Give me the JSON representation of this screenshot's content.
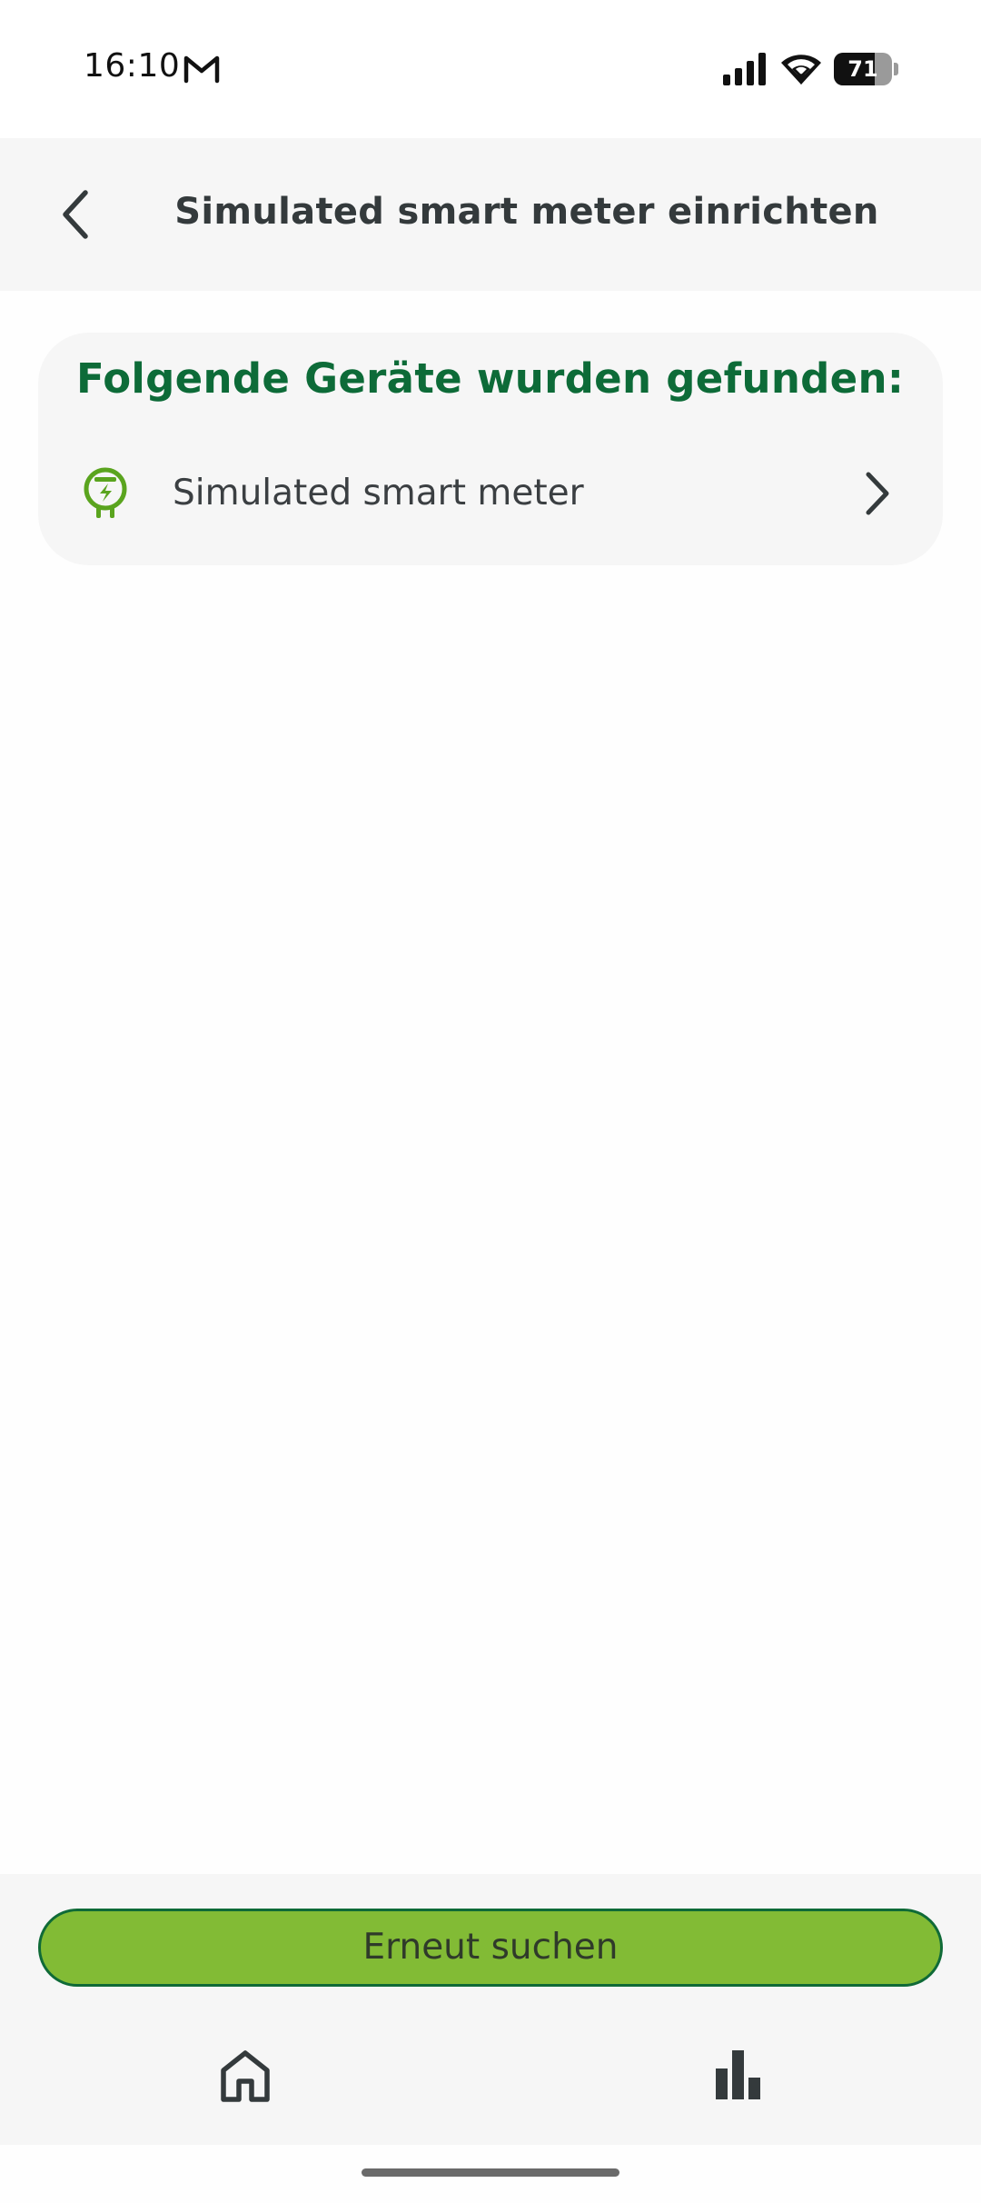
{
  "status_bar": {
    "time": "16:10",
    "notification_icon": "gmail-icon",
    "battery_percent": "71",
    "battery_level": 0.71
  },
  "header": {
    "title": "Simulated smart meter einrichten",
    "back_icon": "chevron-left-icon"
  },
  "devices": {
    "heading": "Folgende Geräte wurden gefunden:",
    "items": [
      {
        "label": "Simulated smart meter",
        "icon": "smart-meter-icon",
        "chevron": "chevron-right-icon"
      }
    ]
  },
  "actions": {
    "search_again_label": "Erneut suchen"
  },
  "bottom_nav": {
    "items": [
      {
        "icon": "home-icon"
      },
      {
        "icon": "bar-chart-icon"
      }
    ]
  },
  "colors": {
    "accent_green": "#82bb35",
    "heading_green": "#0d6b38",
    "text_dark": "#343a3c",
    "surface": "#f6f6f6"
  }
}
